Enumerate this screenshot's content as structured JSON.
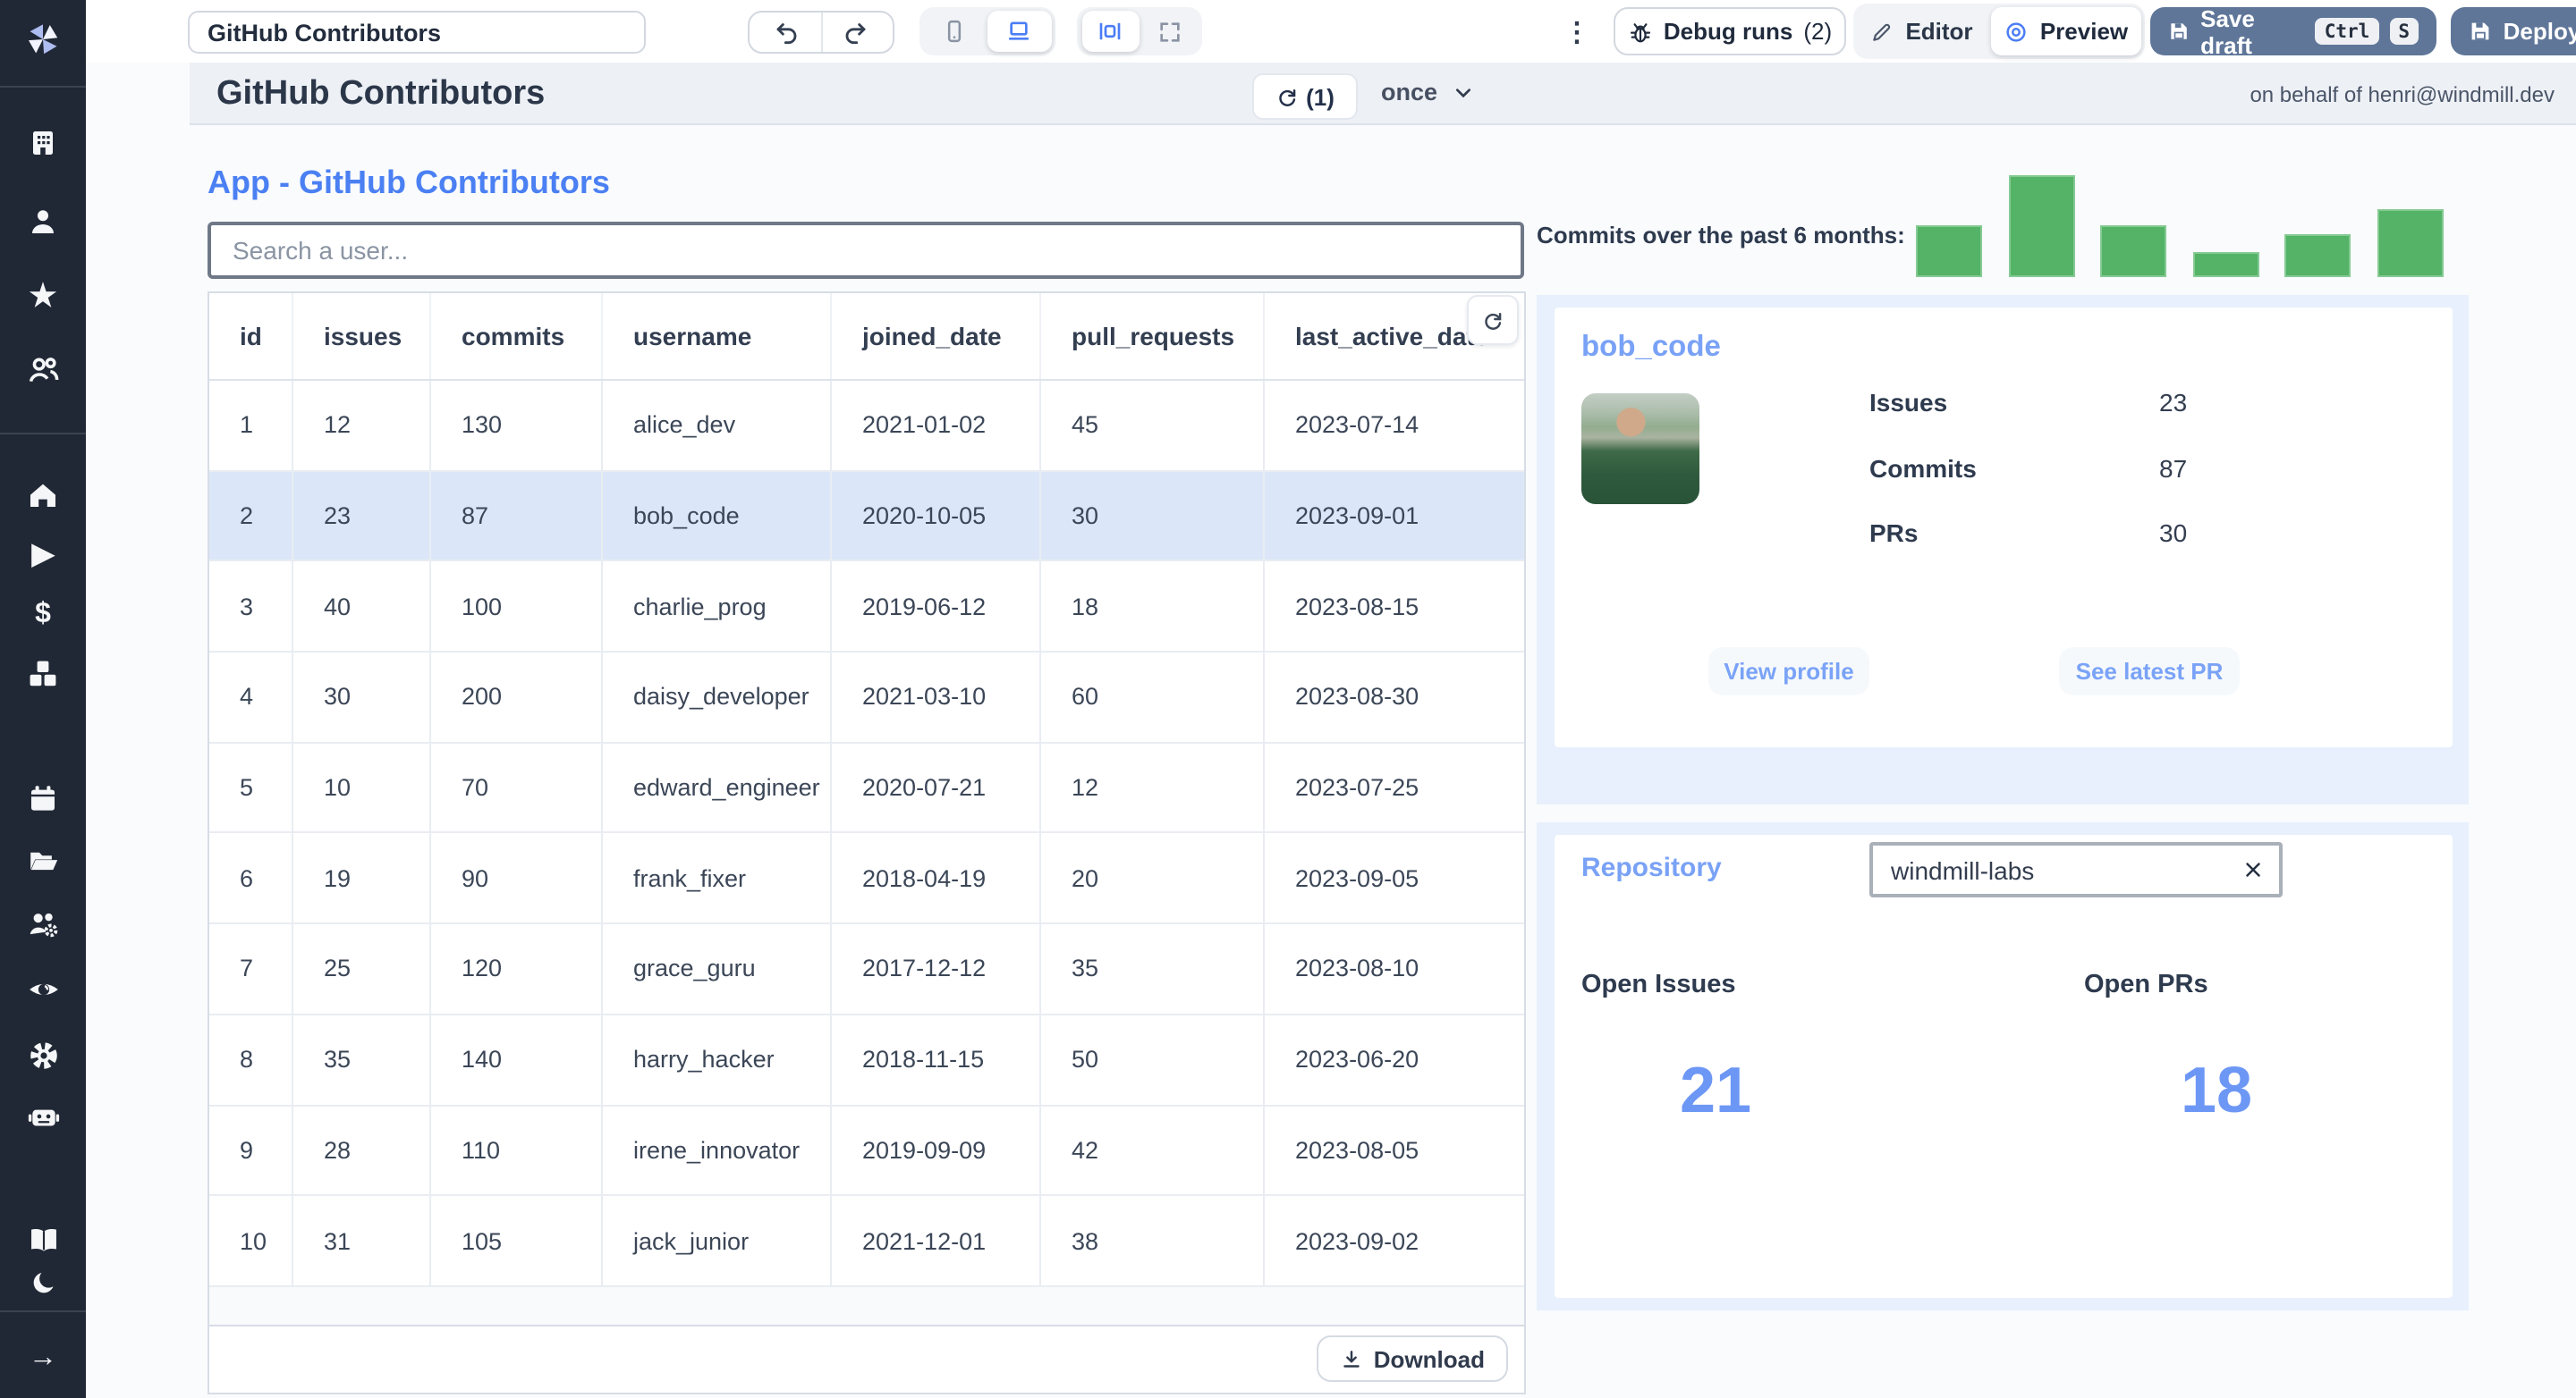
{
  "colors": {
    "accent_blue": "#4b80f3",
    "light_blue_text": "#79a2f6",
    "metric_blue": "#6d97f5",
    "bar_green": "#54b367",
    "section_bg": "#e7f0fc",
    "selected_row": "#dbe7f8",
    "slate_button": "#5f7699",
    "sidebar_bg": "#212835"
  },
  "sidebar": {
    "icons": [
      "windmill-logo",
      "building",
      "user",
      "star",
      "users",
      "home",
      "play",
      "dollar",
      "boxes",
      "calendar",
      "folder-open",
      "users-gear",
      "eye",
      "gear",
      "robot",
      "book-open",
      "moon",
      "arrow-right"
    ]
  },
  "topbar": {
    "app_title_input": "GitHub Contributors",
    "debug_runs_label": "Debug runs",
    "debug_runs_count": "(2)",
    "editor_label": "Editor",
    "preview_label": "Preview",
    "save_draft_label": "Save draft",
    "kbd_ctrl": "Ctrl",
    "kbd_s": "S",
    "deploy_label": "Deploy"
  },
  "app_header": {
    "title": "GitHub Contributors",
    "refresh_count": "(1)",
    "schedule_label": "once",
    "on_behalf": "on behalf of henri@windmill.dev"
  },
  "main": {
    "heading": "App - GitHub Contributors",
    "search_placeholder": "Search a user...",
    "table": {
      "columns": [
        "id",
        "issues",
        "commits",
        "username",
        "joined_date",
        "pull_requests",
        "last_active_date"
      ],
      "rows": [
        [
          "1",
          "12",
          "130",
          "alice_dev",
          "2021-01-02",
          "45",
          "2023-07-14"
        ],
        [
          "2",
          "23",
          "87",
          "bob_code",
          "2020-10-05",
          "30",
          "2023-09-01"
        ],
        [
          "3",
          "40",
          "100",
          "charlie_prog",
          "2019-06-12",
          "18",
          "2023-08-15"
        ],
        [
          "4",
          "30",
          "200",
          "daisy_developer",
          "2021-03-10",
          "60",
          "2023-08-30"
        ],
        [
          "5",
          "10",
          "70",
          "edward_engineer",
          "2020-07-21",
          "12",
          "2023-07-25"
        ],
        [
          "6",
          "19",
          "90",
          "frank_fixer",
          "2018-04-19",
          "20",
          "2023-09-05"
        ],
        [
          "7",
          "25",
          "120",
          "grace_guru",
          "2017-12-12",
          "35",
          "2023-08-10"
        ],
        [
          "8",
          "35",
          "140",
          "harry_hacker",
          "2018-11-15",
          "50",
          "2023-06-20"
        ],
        [
          "9",
          "28",
          "110",
          "irene_innovator",
          "2019-09-09",
          "42",
          "2023-08-05"
        ],
        [
          "10",
          "31",
          "105",
          "jack_junior",
          "2021-12-01",
          "38",
          "2023-09-02"
        ]
      ],
      "selected_row_index": 1,
      "download_label": "Download"
    }
  },
  "chart_data": {
    "type": "bar",
    "title": "Commits over the past 6 months:",
    "categories": [
      "",
      "",
      "",
      "",
      "",
      ""
    ],
    "values": [
      60,
      120,
      60,
      30,
      50,
      80
    ],
    "ylim": [
      0,
      120
    ],
    "bar_color": "#54b367",
    "grid": false,
    "legend": false
  },
  "contributor_card": {
    "username": "bob_code",
    "stats": [
      {
        "label": "Issues",
        "value": "23"
      },
      {
        "label": "Commits",
        "value": "87"
      },
      {
        "label": "PRs",
        "value": "30"
      }
    ],
    "buttons": [
      "View profile",
      "See latest PR"
    ]
  },
  "repository_card": {
    "title": "Repository",
    "input_value": "windmill-labs",
    "open_issues_label": "Open Issues",
    "open_issues_value": "21",
    "open_prs_label": "Open PRs",
    "open_prs_value": "18"
  }
}
